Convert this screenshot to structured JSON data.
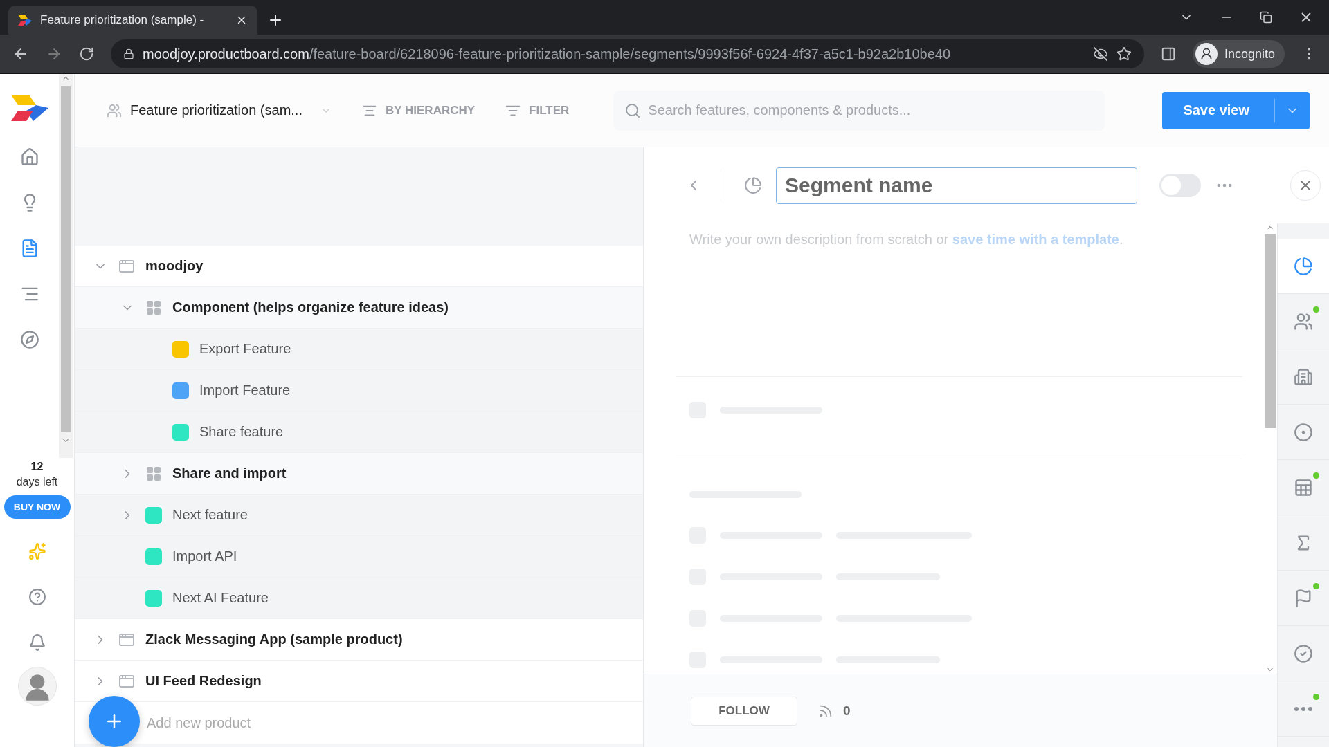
{
  "browser": {
    "tab_title": "Feature prioritization (sample) -",
    "url_domain": "moodjoy.productboard.com",
    "url_path": "/feature-board/6218096-feature-prioritization-sample/segments/9993f56f-6924-4f37-a5c1-b92a2b10be40",
    "profile": "Incognito"
  },
  "nav": {
    "items": [
      {
        "kind": "home",
        "selected": false
      },
      {
        "kind": "insights",
        "selected": false
      },
      {
        "kind": "board",
        "selected": true
      },
      {
        "kind": "roadmap",
        "selected": false
      },
      {
        "kind": "portal",
        "selected": false
      }
    ],
    "trial_days": "12",
    "trial_label": "days left",
    "buy_button": "BUY NOW"
  },
  "toolbar": {
    "board_name": "Feature prioritization (sam...",
    "grouping": "BY HIERARCHY",
    "filter": "FILTER",
    "search_placeholder": "Search features, components & products...",
    "save_button": "Save view"
  },
  "tree": [
    {
      "kind": "product",
      "label": "moodjoy",
      "expanded": true,
      "children": [
        {
          "kind": "component",
          "label": "Component (helps organize feature ideas)",
          "expanded": true,
          "children": [
            {
              "kind": "feature",
              "label": "Export Feature",
              "color": "#f8c500"
            },
            {
              "kind": "feature",
              "label": "Import Feature",
              "color": "#4fa3f7"
            },
            {
              "kind": "feature",
              "label": "Share feature",
              "color": "#2ee6c2"
            }
          ]
        },
        {
          "kind": "component",
          "label": "Share and import",
          "expanded": false
        },
        {
          "kind": "feature",
          "label": "Next feature",
          "color": "#2ee6c2",
          "expanded": false
        },
        {
          "kind": "feature",
          "label": "Import API",
          "color": "#2ee6c2"
        },
        {
          "kind": "feature",
          "label": "Next AI Feature",
          "color": "#2ee6c2"
        }
      ]
    },
    {
      "kind": "product",
      "label": "Zlack Messaging App (sample product)",
      "expanded": false
    },
    {
      "kind": "product",
      "label": "UI Feed Redesign",
      "expanded": false
    }
  ],
  "add_product_placeholder": "Add new product",
  "detail": {
    "name_value": "Segment name",
    "toggle_on": false,
    "description": "Write your own description from scratch or ",
    "description_link": "save time with a template",
    "description_end": ".",
    "follow_button": "FOLLOW",
    "followers": "0"
  },
  "rail": [
    {
      "kind": "segment",
      "selected": true,
      "dot": false
    },
    {
      "kind": "users",
      "selected": false,
      "dot": true
    },
    {
      "kind": "company",
      "selected": false,
      "dot": false
    },
    {
      "kind": "target",
      "selected": false,
      "dot": false
    },
    {
      "kind": "table",
      "selected": false,
      "dot": true
    },
    {
      "kind": "sum",
      "selected": false,
      "dot": false
    },
    {
      "kind": "flag",
      "selected": false,
      "dot": true
    },
    {
      "kind": "check",
      "selected": false,
      "dot": false
    },
    {
      "kind": "more",
      "selected": false,
      "dot": true
    }
  ]
}
